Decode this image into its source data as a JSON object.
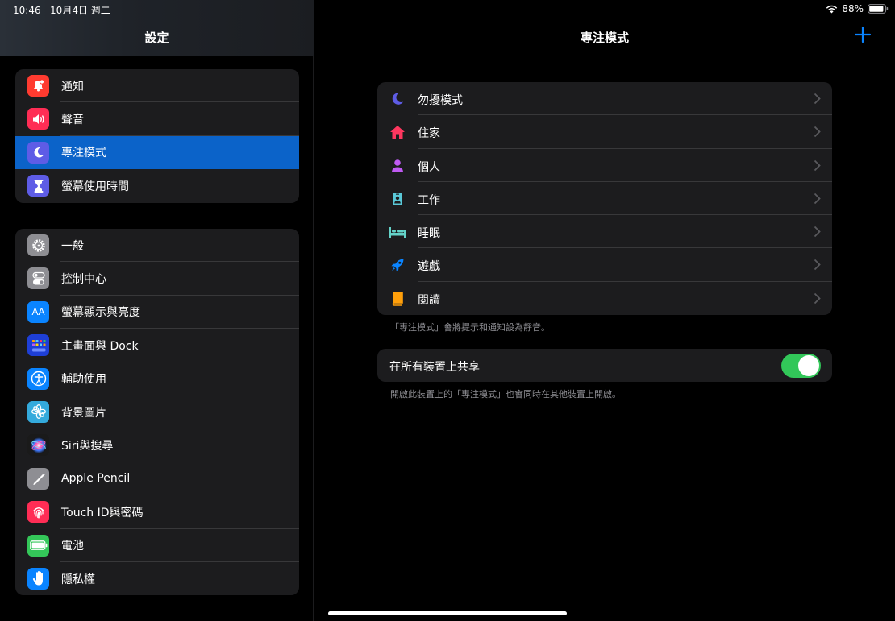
{
  "status": {
    "time": "10:46",
    "date": "10月4日 週二",
    "battery": "88%"
  },
  "sidebar": {
    "title": "設定",
    "group1": [
      {
        "label": "通知",
        "icon": "bell-badge-icon",
        "color": "#ff3b30"
      },
      {
        "label": "聲音",
        "icon": "speaker-icon",
        "color": "#ff2d55"
      },
      {
        "label": "專注模式",
        "icon": "moon-icon",
        "color": "#5e5ce6",
        "selected": true
      },
      {
        "label": "螢幕使用時間",
        "icon": "hourglass-icon",
        "color": "#5e5ce6"
      }
    ],
    "group2": [
      {
        "label": "一般",
        "icon": "gear-icon",
        "color": "#8e8e93"
      },
      {
        "label": "控制中心",
        "icon": "toggles-icon",
        "color": "#8e8e93"
      },
      {
        "label": "螢幕顯示與亮度",
        "icon": "text-size-icon",
        "color": "#0a84ff",
        "glyph": "AA"
      },
      {
        "label": "主畫面與 Dock",
        "icon": "home-grid-icon",
        "color": "#1e3fd6"
      },
      {
        "label": "輔助使用",
        "icon": "accessibility-icon",
        "color": "#0a84ff"
      },
      {
        "label": "背景圖片",
        "icon": "flower-icon",
        "color": "#34aadc"
      },
      {
        "label": "Siri與搜尋",
        "icon": "siri-icon",
        "color": "#222222"
      },
      {
        "label": "Apple Pencil",
        "icon": "pencil-icon",
        "color": "#8e8e93"
      },
      {
        "label": "Touch ID與密碼",
        "icon": "fingerprint-icon",
        "color": "#ff2d55"
      },
      {
        "label": "電池",
        "icon": "battery-icon",
        "color": "#34c759"
      },
      {
        "label": "隱私權",
        "icon": "hand-icon",
        "color": "#0a84ff"
      }
    ]
  },
  "main": {
    "title": "專注模式",
    "focus_modes": [
      {
        "label": "勿擾模式",
        "icon": "moon-icon",
        "color": "#5e5ce6"
      },
      {
        "label": "住家",
        "icon": "house-icon",
        "color": "#ff375f"
      },
      {
        "label": "個人",
        "icon": "person-icon",
        "color": "#bf5af2"
      },
      {
        "label": "工作",
        "icon": "id-badge-icon",
        "color": "#5ac8d8"
      },
      {
        "label": "睡眠",
        "icon": "bed-icon",
        "color": "#64d2c8"
      },
      {
        "label": "遊戲",
        "icon": "rocket-icon",
        "color": "#0a84ff"
      },
      {
        "label": "閱讀",
        "icon": "book-icon",
        "color": "#ff9f0a"
      }
    ],
    "modes_footnote": "「專注模式」會將提示和通知設為靜音。",
    "share": {
      "label": "在所有裝置上共享",
      "enabled": true,
      "footnote": "開啟此裝置上的「專注模式」也會同時在其他裝置上開啟。"
    }
  }
}
